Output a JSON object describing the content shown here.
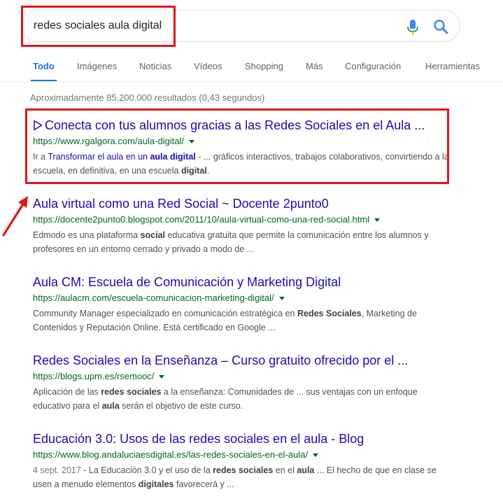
{
  "search": {
    "query": "redes sociales aula digital"
  },
  "tabs": [
    {
      "label": "Todo"
    },
    {
      "label": "Imágenes"
    },
    {
      "label": "Noticias"
    },
    {
      "label": "Vídeos"
    },
    {
      "label": "Shopping"
    },
    {
      "label": "Más"
    },
    {
      "label": "Configuración"
    },
    {
      "label": "Herramientas"
    }
  ],
  "stats": "Aproximadamente 85.200.000 resultados (0,43 segundos)",
  "results": [
    {
      "title": "Conecta con tus alumnos gracias a las Redes Sociales en el Aula ...",
      "url": "https://www.rgalgora.com/aula-digital/",
      "snippet": {
        "prefix": "Ir a ",
        "link_a": "Transformar el aula en un ",
        "link_b": "aula digital",
        "mid": " - ... gráficos interactivos, trabajos colaborativos, convirtiendo a la escuela, en definitiva, en una escuela ",
        "bold": "digital",
        "end": "."
      }
    },
    {
      "title": "Aula virtual como una Red Social ~ Docente 2punto0",
      "url": "https://docente2punto0.blogspot.com/2011/10/aula-virtual-como-una-red-social.html",
      "snippet": {
        "a": "Edmodo es una plataforma ",
        "b": "social",
        "c": " educativa gratuita que permite la comunicación entre los alumnos y profesores en un entorno cerrado y privado a modo de ..."
      }
    },
    {
      "title": "Aula CM: Escuela de Comunicación y Marketing Digital",
      "url": "https://aulacm.com/escuela-comunicacion-marketing-digital/",
      "snippet": {
        "a": "Community Manager especializado en comunicación estratégica en ",
        "b": "Redes Sociales",
        "c": ", Marketing de Contenidos y Reputación Online. Está certificado en Google ..."
      }
    },
    {
      "title": "Redes Sociales en la Enseñanza – Curso gratuito ofrecido por el ...",
      "url": "https://blogs.upm.es/rsemooc/",
      "snippet": {
        "a": "Aplicación de las ",
        "b": "redes sociales",
        "c": " a la enseñanza: Comunidades de ... sus ventajas con un enfoque educativo para el ",
        "d": "aula",
        "e": " serán el objetivo de este curso."
      }
    },
    {
      "title": "Educación 3.0: Usos de las redes sociales en el aula - Blog",
      "url": "https://www.blog.andaluciaesdigital.es/las-redes-sociales-en-el-aula/",
      "snippet": {
        "date": "4 sept. 2017",
        "a": " - La Educación 3.0 y el uso de la ",
        "b": "redes sociales",
        "c": " en el ",
        "d": "aula",
        "e": " ... El hecho de que en clase se usen a menudo elementos ",
        "f": "digitales",
        "g": " favorecerá y ..."
      }
    }
  ],
  "colors": {
    "link": "#1a0dab",
    "url": "#006621",
    "accent": "#1a73e8",
    "annotation": "#e2141b"
  },
  "icons": [
    "microphone-icon",
    "search-icon",
    "play-icon",
    "dropdown-caret-icon",
    "annotation-arrow-icon"
  ]
}
